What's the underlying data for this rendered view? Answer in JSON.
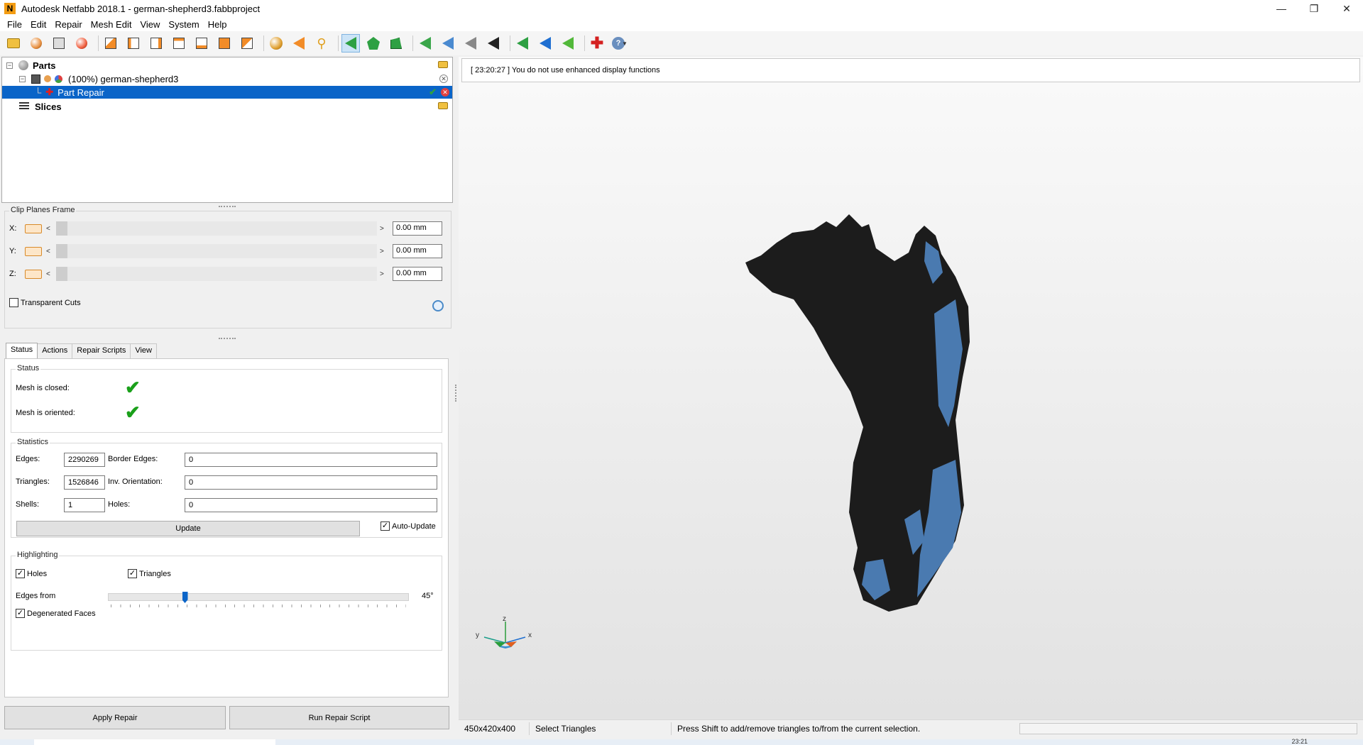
{
  "window": {
    "title": "Autodesk Netfabb 2018.1 - german-shepherd3.fabbproject",
    "logo_letter": "N",
    "minimize": "—",
    "maximize": "❐",
    "close": "✕"
  },
  "menu": [
    "File",
    "Edit",
    "Repair",
    "Mesh Edit",
    "View",
    "System",
    "Help"
  ],
  "toolbar": {
    "icons": [
      "open-project-icon",
      "add-part-icon",
      "create-icon",
      "add-icon",
      "view-front-icon",
      "view-back-icon",
      "view-left-icon",
      "view-right-icon",
      "view-top-icon",
      "view-bottom-icon",
      "view-iso-icon",
      "sphere-icon",
      "arrow-left-icon",
      "zoom-icon",
      "select-triangles-icon",
      "select-surface-icon",
      "select-shell-icon",
      "triangle-green-icon",
      "triangle-blue-icon",
      "triangle-gray-icon",
      "triangle-black-icon",
      "arrow-green-icon",
      "arrow-blue-icon",
      "arrow-green2-icon",
      "new-repair-icon",
      "help-icon"
    ]
  },
  "tree": {
    "parts_label": "Parts",
    "part_name": "(100%) german-shepherd3",
    "repair_label": "Part Repair",
    "slices_label": "Slices"
  },
  "clip": {
    "title": "Clip Planes Frame",
    "x_label": "X:",
    "y_label": "Y:",
    "z_label": "Z:",
    "x_value": "0.00 mm",
    "y_value": "0.00 mm",
    "z_value": "0.00 mm",
    "arrow_left": "<",
    "arrow_right": ">",
    "transparent_label": "Transparent Cuts"
  },
  "tabs": [
    "Status",
    "Actions",
    "Repair Scripts",
    "View"
  ],
  "status": {
    "group_title": "Status",
    "closed_label": "Mesh is closed:",
    "oriented_label": "Mesh is oriented:",
    "check_mark": "✔"
  },
  "statistics": {
    "group_title": "Statistics",
    "edges_label": "Edges:",
    "edges": "2290269",
    "border_edges_label": "Border Edges:",
    "border_edges": "0",
    "triangles_label": "Triangles:",
    "triangles": "1526846",
    "inv_orientation_label": "Inv. Orientation:",
    "inv_orientation": "0",
    "shells_label": "Shells:",
    "shells": "1",
    "holes_label": "Holes:",
    "holes": "0",
    "update_label": "Update",
    "auto_update_label": "Auto-Update"
  },
  "highlighting": {
    "group_title": "Highlighting",
    "holes_label": "Holes",
    "triangles_label": "Triangles",
    "edges_from_label": "Edges from",
    "edges_from_value": "45°",
    "edges_from_fraction": 0.25,
    "degenerated_label": "Degenerated Faces"
  },
  "buttons": {
    "apply_repair": "Apply Repair",
    "run_script": "Run Repair Script"
  },
  "viewport": {
    "log_message": "[ 23:20:27 ] You do not use enhanced display functions",
    "axis_x": "x",
    "axis_y": "y",
    "axis_z": "z",
    "model_color": "#1c1c1c",
    "highlight_color": "#4a7ab0"
  },
  "statusbar": {
    "dimensions": "450x420x400",
    "mode": "Select Triangles",
    "hint": "Press Shift to add/remove triangles to/from the current selection."
  },
  "taskbar": {
    "clock": "23:21"
  }
}
